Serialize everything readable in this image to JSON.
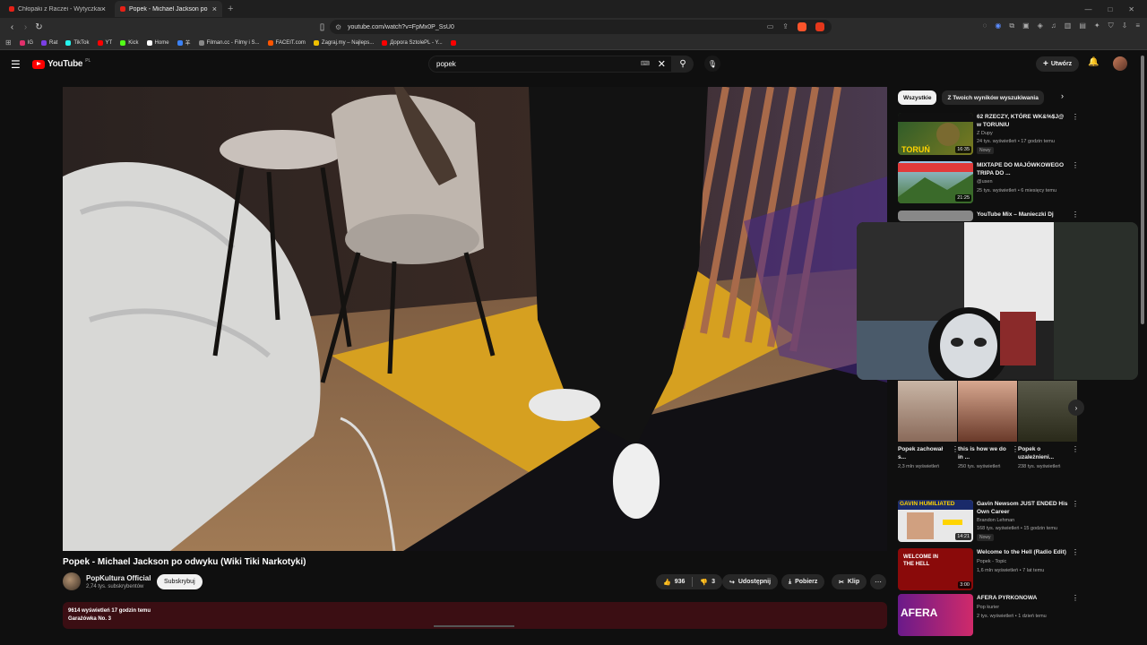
{
  "browser": {
    "tabs": [
      {
        "label": "Chłopaki z Raczei - Wytyczkarz bawi",
        "active": false
      },
      {
        "label": "Popek - Michael Jackson po",
        "active": true
      }
    ],
    "new_tab": "+",
    "url": "youtube.com/watch?v=FpMx0P_SsU0",
    "bookmarks": [
      {
        "label": "IG",
        "color": "#e1306c"
      },
      {
        "label": "Rat",
        "color": "#7b3fe4"
      },
      {
        "label": "TikTok",
        "color": "#25f4ee"
      },
      {
        "label": "YT",
        "color": "#ff0000"
      },
      {
        "label": "Kick",
        "color": "#53fc18"
      },
      {
        "label": "Home",
        "color": "#ffffff"
      },
      {
        "label": "羊",
        "color": "#3b82f6"
      },
      {
        "label": "Filman.cc - Filmy i S...",
        "color": "#888888"
      },
      {
        "label": "FACEIT.com",
        "color": "#ff5500"
      },
      {
        "label": "Zagraj.my – Najleps...",
        "color": "#f0c000"
      },
      {
        "label": "Дорога SztolePL - Y...",
        "color": "#ff0000"
      },
      {
        "label": "",
        "color": "#ff0000"
      }
    ]
  },
  "youtube": {
    "logo_text": "YouTube",
    "logo_region": "PL",
    "search_value": "popek",
    "create_label": "Utwórz"
  },
  "video": {
    "title": "Popek - Michael Jackson po odwyku (Wiki Tiki Narkotyki)",
    "channel": "PopKultura Official",
    "subscribers": "2,74 tys. subskrybentów",
    "subscribe_label": "Subskrybuj",
    "likes": "936",
    "dislikes": "3",
    "share_label": "Udostępnij",
    "download_label": "Pobierz",
    "clip_label": "Klip",
    "views_line": "9614 wyświetleń  17 godzin temu",
    "desc_line2": "Garażówka No. 3"
  },
  "chips": [
    "Wszystkie",
    "Z Twoich wyników wyszukiwania"
  ],
  "recommendations_top": [
    {
      "title": "62 RZECZY, KTÓRE WK&%$J@ w TORUNIU",
      "channel": "Z Dupy",
      "meta": "24 tys. wyświetleń • 17 godzin temu",
      "badge": "Nowy",
      "duration": "16:35",
      "thumb_color": "#2a5a2a"
    },
    {
      "title": "MIXTAPE DO MAJÓWKOWEGO TRIPA DO ...",
      "channel": "@usen",
      "meta": "25 tys. wyświetleń • 6 miesięcy temu",
      "badge": "",
      "duration": "21:25",
      "thumb_color": "#4a7a3a"
    },
    {
      "title": "YouTube Mix – Manieczki Dj",
      "channel": "",
      "meta": "",
      "badge": "",
      "duration": "",
      "thumb_color": "#888888"
    }
  ],
  "shorts": [
    {
      "title": "Popek zachował s...",
      "views": "2,3 mln wyświetleń"
    },
    {
      "title": "this is how we do in ...",
      "views": "250 tys. wyświetleń"
    },
    {
      "title": "Popek o uzależnieni...",
      "views": "238 tys. wyświetleń"
    }
  ],
  "recommendations_bottom": [
    {
      "title": "Gavin Newsom JUST ENDED His Own Career",
      "channel": "Brandon Lehman",
      "meta": "168 tys. wyświetleń • 15 godzin temu",
      "badge": "Nowy",
      "duration": "14:21",
      "thumb_text": "GAVIN HUMILIATED"
    },
    {
      "title": "Welcome to the Hell (Radio Edit)",
      "channel": "Popek - Topic",
      "meta": "1,6 mln wyświetleń • 7 lat temu",
      "badge": "",
      "duration": "3:00",
      "thumb_text": "WELCOME IN THE HELL"
    },
    {
      "title": "AFERA PYRKONOWA",
      "channel": "Pop kurier",
      "meta": "2 tys. wyświetleń • 1 dzień temu",
      "badge": "",
      "duration": "",
      "thumb_text": "AFERA"
    }
  ],
  "accent": "#ff0000"
}
